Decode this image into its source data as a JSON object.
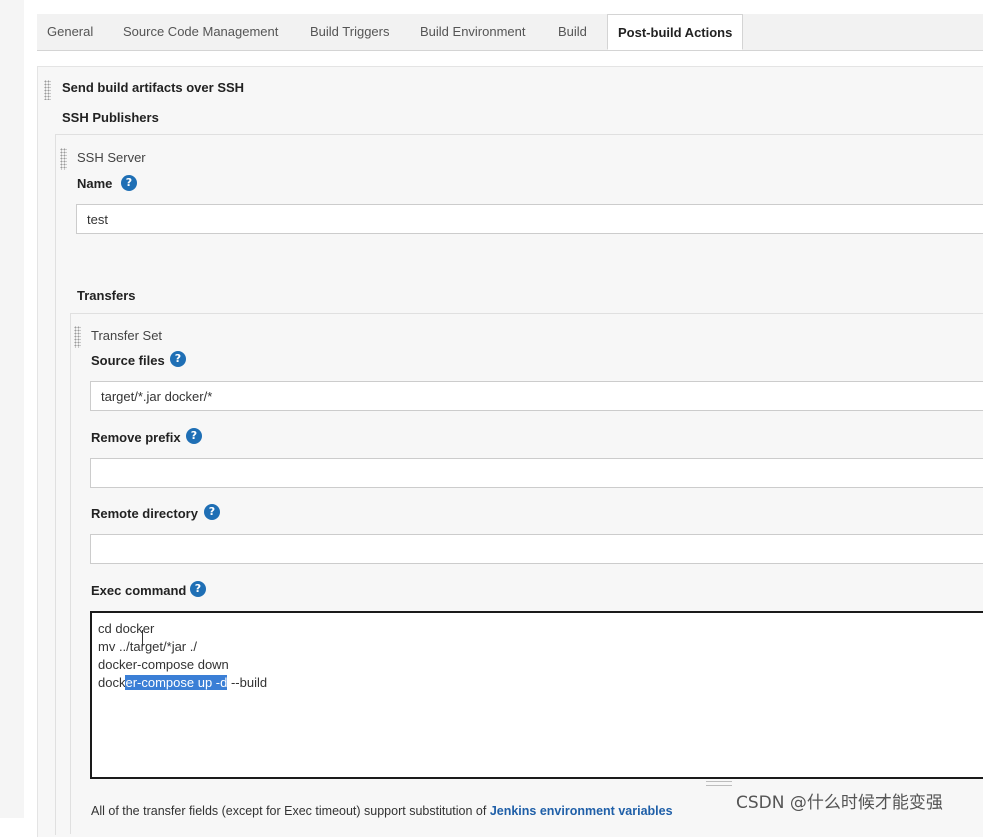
{
  "tabs": [
    {
      "label": "General",
      "active": false
    },
    {
      "label": "Source Code Management",
      "active": false
    },
    {
      "label": "Build Triggers",
      "active": false
    },
    {
      "label": "Build Environment",
      "active": false
    },
    {
      "label": "Build",
      "active": false
    },
    {
      "label": "Post-build Actions",
      "active": true
    }
  ],
  "section": {
    "title": "Send build artifacts over SSH",
    "publishers_label": "SSH Publishers"
  },
  "server": {
    "heading": "SSH Server",
    "name_label": "Name",
    "name_value": "test",
    "transfers_label": "Transfers"
  },
  "transfer_set": {
    "heading": "Transfer Set",
    "source_files_label": "Source files",
    "source_files_value": "target/*.jar docker/*",
    "remove_prefix_label": "Remove prefix",
    "remove_prefix_value": "",
    "remote_directory_label": "Remote directory",
    "remote_directory_value": "",
    "exec_command_label": "Exec command",
    "exec_lines": [
      "cd docker",
      "mv ../target/*jar ./",
      "docker-compose down"
    ],
    "exec_line4": {
      "before": "dock",
      "selected": "er-compose up -d",
      "after": " --build"
    }
  },
  "footer": {
    "note_text": "All of the transfer fields (except for Exec timeout) support substitution of ",
    "note_link": "Jenkins environment variables"
  },
  "help_glyph": "?",
  "watermark": "CSDN @什么时候才能变强",
  "colors": {
    "help_icon": "#1f6fb5",
    "selection": "#3b7fd6",
    "link": "#1f5fa8"
  }
}
